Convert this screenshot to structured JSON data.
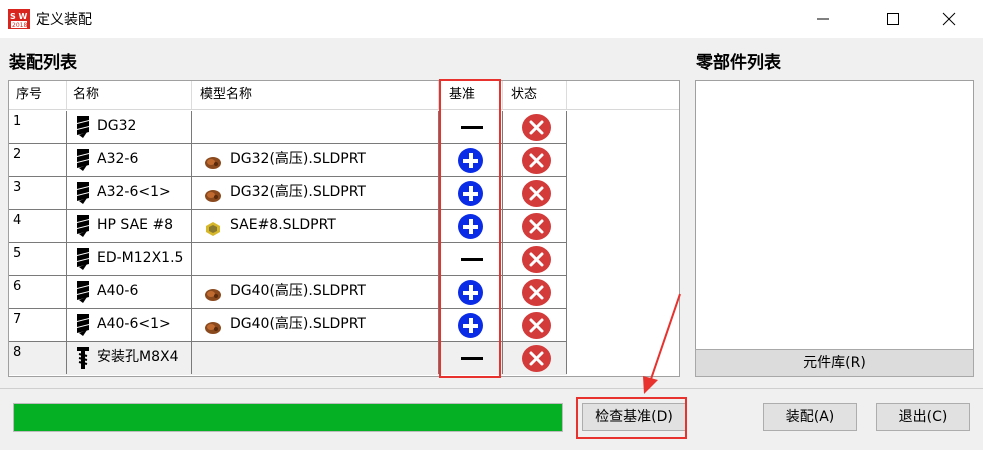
{
  "window": {
    "title": "定义装配"
  },
  "assembly_section": {
    "title": "装配列表"
  },
  "parts_section": {
    "title": "零部件列表"
  },
  "table": {
    "headers": {
      "seq": "序号",
      "name": "名称",
      "model": "模型名称",
      "base": "基准",
      "status": "状态"
    },
    "rows": [
      {
        "seq": "1",
        "name": "DG32",
        "model": "",
        "model_icon": "",
        "base": "minus",
        "name_icon": "drill-icon"
      },
      {
        "seq": "2",
        "name": "A32-6",
        "model": "DG32(高压).SLDPRT",
        "model_icon": "brown-part-icon",
        "base": "plus",
        "name_icon": "drill-icon"
      },
      {
        "seq": "3",
        "name": "A32-6<1>",
        "model": "DG32(高压).SLDPRT",
        "model_icon": "brown-part-icon",
        "base": "plus",
        "name_icon": "drill-icon"
      },
      {
        "seq": "4",
        "name": "HP SAE #8",
        "model": "SAE#8.SLDPRT",
        "model_icon": "yellow-part-icon",
        "base": "plus",
        "name_icon": "drill-icon"
      },
      {
        "seq": "5",
        "name": "ED-M12X1.5",
        "model": "",
        "model_icon": "",
        "base": "minus",
        "name_icon": "drill-icon"
      },
      {
        "seq": "6",
        "name": "A40-6",
        "model": "DG40(高压).SLDPRT",
        "model_icon": "brown-part-icon",
        "base": "plus",
        "name_icon": "drill-icon"
      },
      {
        "seq": "7",
        "name": "A40-6<1>",
        "model": "DG40(高压).SLDPRT",
        "model_icon": "brown-part-icon",
        "base": "plus",
        "name_icon": "drill-icon"
      },
      {
        "seq": "8",
        "name": "安装孔M8X4",
        "model": "",
        "model_icon": "",
        "base": "minus",
        "name_icon": "tap-icon"
      }
    ]
  },
  "buttons": {
    "library": "元件库(R)",
    "check_base": "检查基准(D)",
    "assemble": "装配(A)",
    "exit": "退出(C)"
  },
  "progress": {
    "value": 1.0,
    "color": "#06b025"
  },
  "colors": {
    "highlight": "#e8322e",
    "plus": "#0b2ce6",
    "status_x": "#d33a3a"
  }
}
